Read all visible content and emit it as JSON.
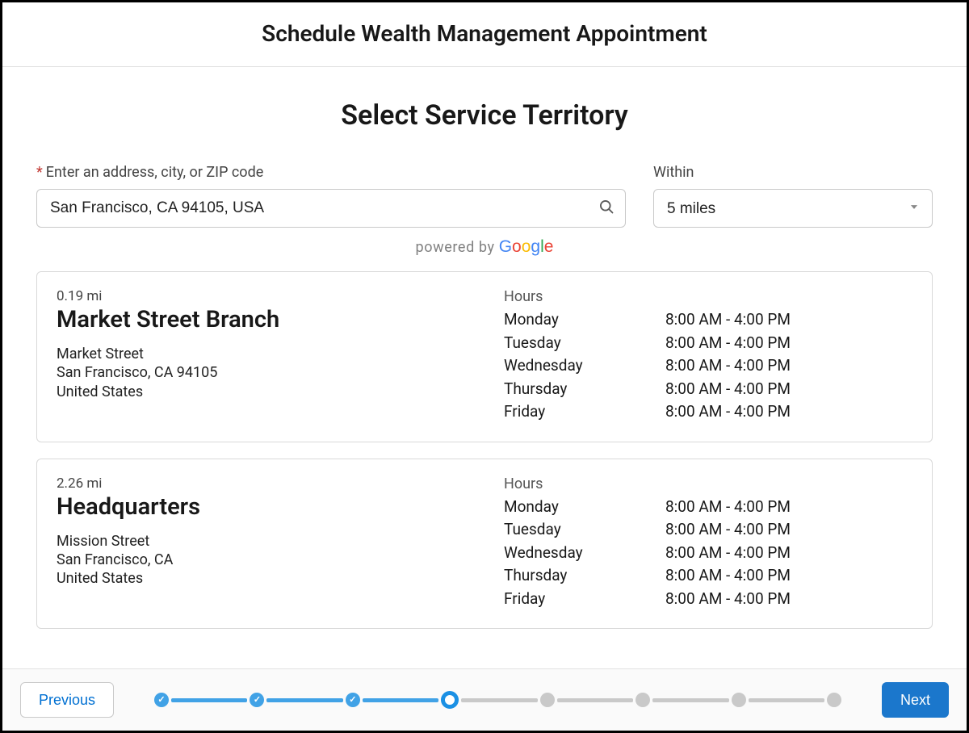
{
  "header": {
    "title": "Schedule Wealth Management Appointment"
  },
  "subtitle": "Select Service Territory",
  "search": {
    "label": "Enter an address, city, or ZIP code",
    "required_marker": "*",
    "value": "San Francisco, CA 94105, USA",
    "powered_prefix": "powered by ",
    "google_letters": [
      "G",
      "o",
      "o",
      "g",
      "l",
      "e"
    ]
  },
  "within": {
    "label": "Within",
    "value": "5 miles"
  },
  "locations": [
    {
      "distance": "0.19 mi",
      "name": "Market Street Branch",
      "address": [
        "Market Street",
        "San Francisco, CA 94105",
        "United States"
      ],
      "hours_label": "Hours",
      "hours": [
        {
          "day": "Monday",
          "time": "8:00 AM - 4:00 PM"
        },
        {
          "day": "Tuesday",
          "time": "8:00 AM - 4:00 PM"
        },
        {
          "day": "Wednesday",
          "time": "8:00 AM - 4:00 PM"
        },
        {
          "day": "Thursday",
          "time": "8:00 AM - 4:00 PM"
        },
        {
          "day": "Friday",
          "time": "8:00 AM - 4:00 PM"
        }
      ]
    },
    {
      "distance": "2.26 mi",
      "name": "Headquarters",
      "address": [
        "Mission Street",
        "San Francisco, CA",
        "United States"
      ],
      "hours_label": "Hours",
      "hours": [
        {
          "day": "Monday",
          "time": "8:00 AM - 4:00 PM"
        },
        {
          "day": "Tuesday",
          "time": "8:00 AM - 4:00 PM"
        },
        {
          "day": "Wednesday",
          "time": "8:00 AM - 4:00 PM"
        },
        {
          "day": "Thursday",
          "time": "8:00 AM - 4:00 PM"
        },
        {
          "day": "Friday",
          "time": "8:00 AM - 4:00 PM"
        }
      ]
    }
  ],
  "stepper": {
    "total": 8,
    "current_index": 3,
    "states": [
      "done",
      "done",
      "done",
      "current",
      "todo",
      "todo",
      "todo",
      "todo"
    ]
  },
  "buttons": {
    "previous": "Previous",
    "next": "Next"
  }
}
